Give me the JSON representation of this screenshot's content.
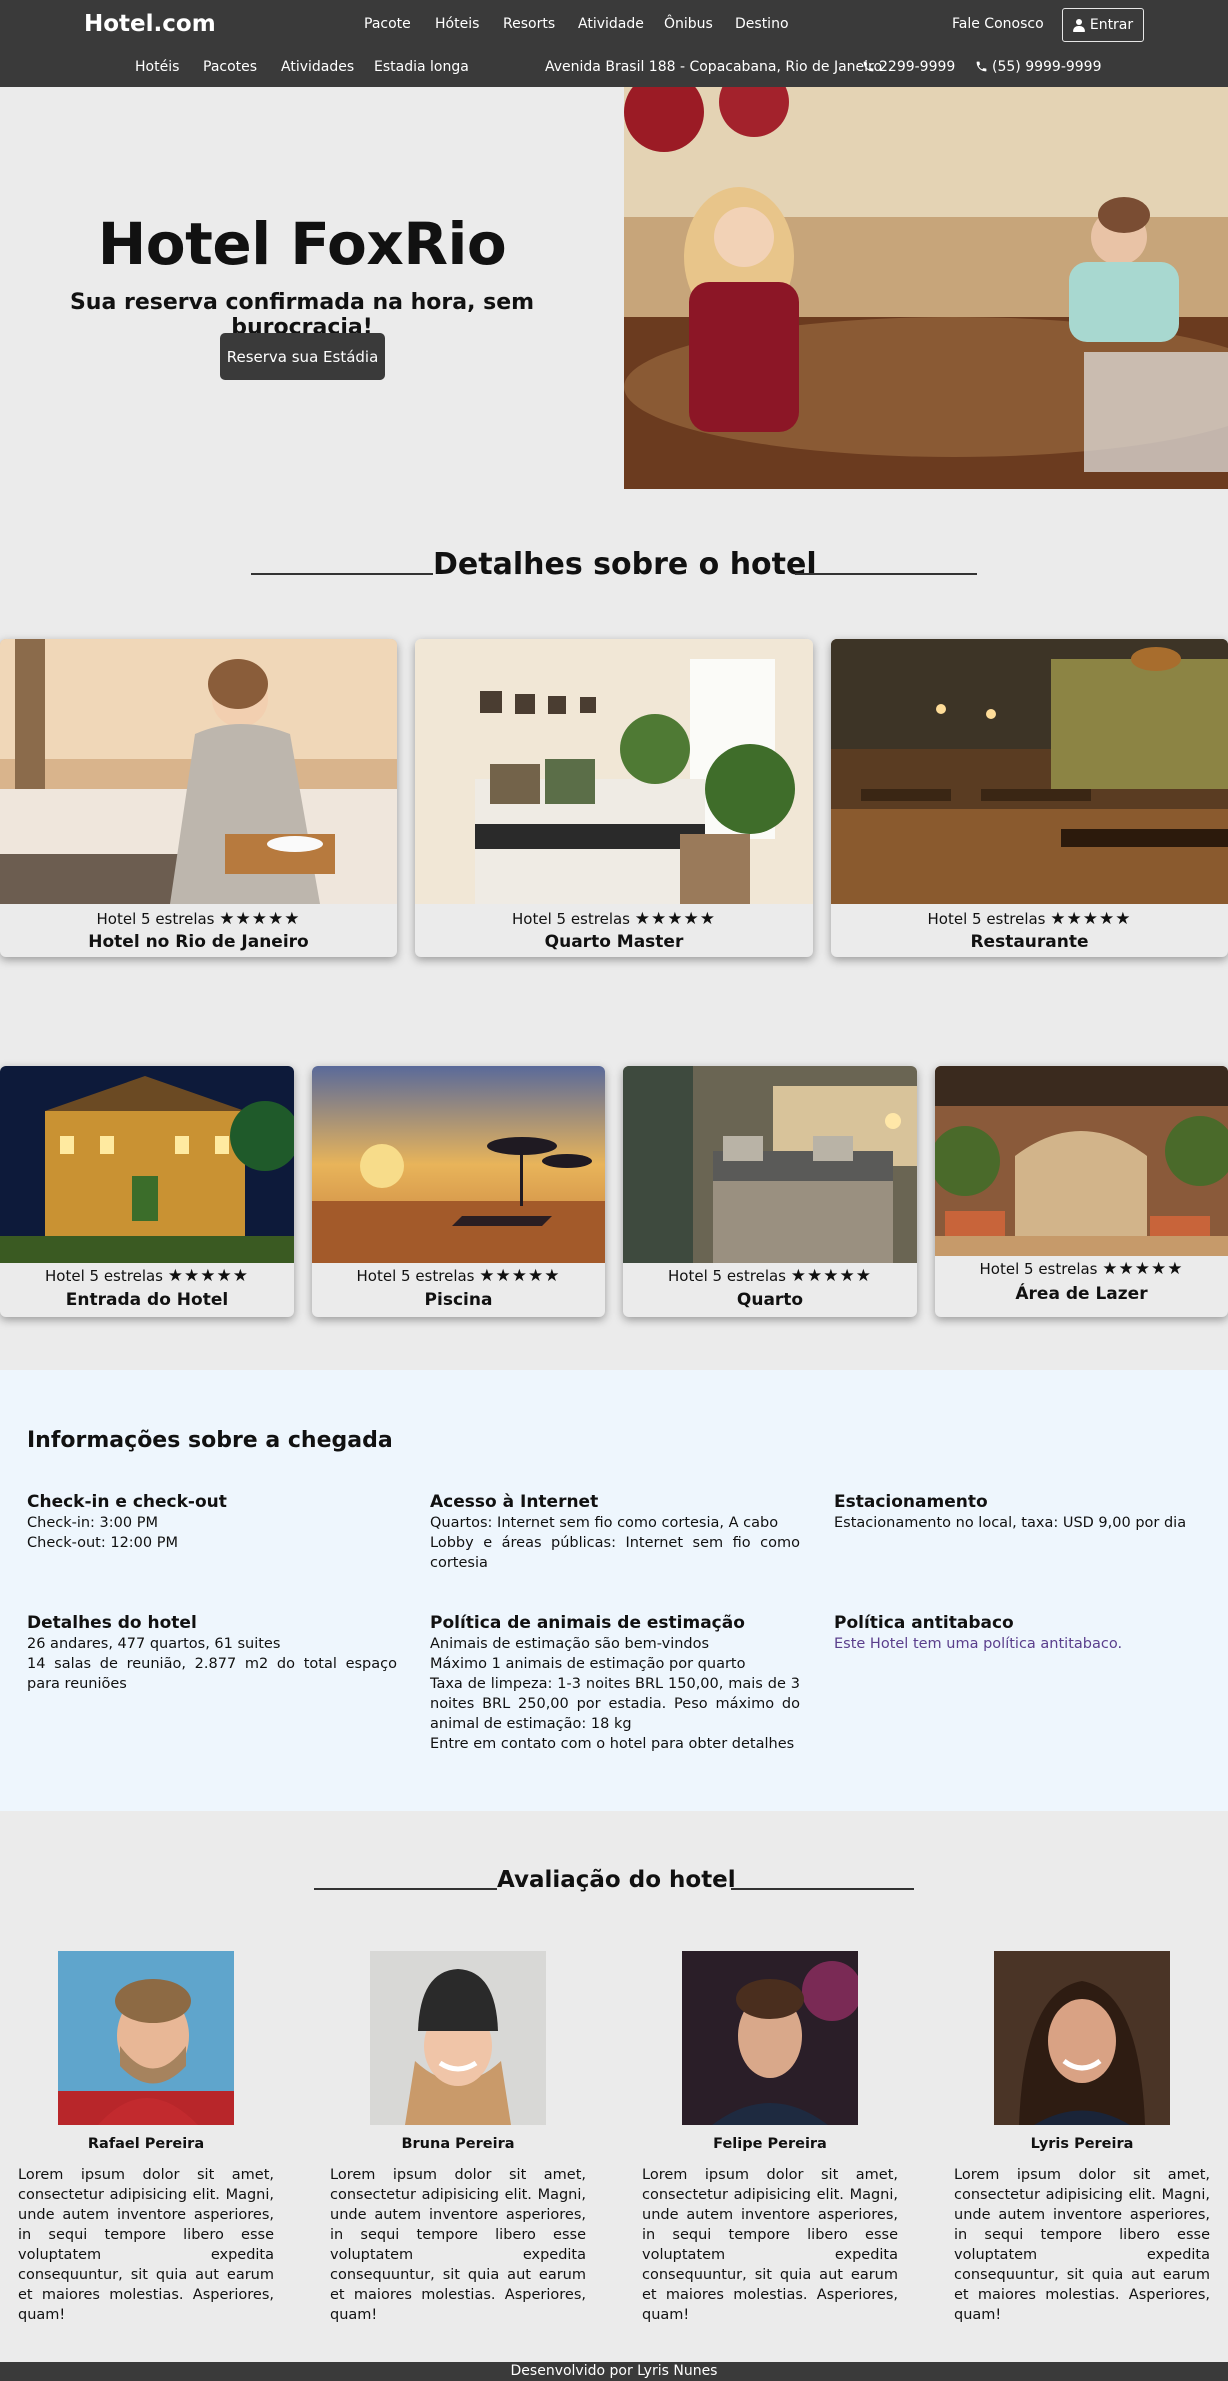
{
  "header": {
    "logo": "Hotel.com",
    "nav": [
      "Pacote",
      "Hóteis",
      "Resorts",
      "Atividade",
      "Ônibus",
      "Destino"
    ],
    "contact_link": "Fale Conosco",
    "login_label": "Entrar",
    "subnav": [
      "Hotéis",
      "Pacotes",
      "Atividades",
      "Estadia longa"
    ],
    "address": "Avenida Brasil 188 - Copacabana, Rio de Janeiro",
    "phone1": "2299-9999",
    "phone2": "(55) 9999-9999"
  },
  "hero": {
    "title": "Hotel FoxRio",
    "subtitle": "Sua reserva confirmada na hora, sem burocracia!",
    "button_label": "Reserva sua Estádia"
  },
  "details": {
    "title": "Detalhes sobre o hotel",
    "stars": "★★★★★",
    "cards_row1": [
      {
        "rating": "Hotel 5 estrelas",
        "title": "Hotel no Rio de Janeiro"
      },
      {
        "rating": "Hotel 5 estrelas",
        "title": "Quarto Master"
      },
      {
        "rating": "Hotel 5 estrelas",
        "title": "Restaurante"
      }
    ],
    "cards_row2": [
      {
        "rating": "Hotel 5 estrelas",
        "title": "Entrada do Hotel"
      },
      {
        "rating": "Hotel 5 estrelas",
        "title": "Piscina"
      },
      {
        "rating": "Hotel 5 estrelas",
        "title": "Quarto"
      },
      {
        "rating": "Hotel 5 estrelas",
        "title": "Área de Lazer"
      }
    ]
  },
  "arrival": {
    "title": "Informações sobre a chegada",
    "checkin": {
      "heading": "Check-in e check-out",
      "lines": [
        "Check-in: 3:00 PM",
        "Check-out: 12:00 PM"
      ]
    },
    "internet": {
      "heading": "Acesso à Internet",
      "lines": [
        "Quartos: Internet sem fio como cortesia, A cabo",
        "Lobby e áreas públicas: Internet sem fio como cortesia"
      ]
    },
    "parking": {
      "heading": "Estacionamento",
      "lines": [
        "Estacionamento no local, taxa: USD 9,00 por dia"
      ]
    },
    "hotel": {
      "heading": "Detalhes do hotel",
      "lines": [
        "26 andares, 477 quartos, 61 suites",
        "14 salas de reunião, 2.877 m2 do total espaço para reuniões"
      ]
    },
    "pets": {
      "heading": "Política de animais de estimação",
      "lines": [
        "Animais de estimação são bem-vindos",
        "Máximo 1 animais de estimação por quarto",
        "Taxa de limpeza: 1-3 noites BRL 150,00, mais de 3 noites BRL 250,00 por estadia. Peso máximo do animal de estimação: 18 kg",
        "Entre em contato com o hotel para obter detalhes"
      ]
    },
    "smoking": {
      "heading": "Política antitabaco",
      "link": "Este Hotel tem uma política antitabaco."
    }
  },
  "reviews": {
    "title": "Avaliação do hotel",
    "items": [
      {
        "name": "Rafael Pereira",
        "text": "Lorem ipsum dolor sit amet, consectetur adipisicing elit. Magni, unde autem inventore asperiores, in sequi tempore libero esse voluptatem expedita consequuntur, sit quia aut earum et maiores molestias. Asperiores, quam!"
      },
      {
        "name": "Bruna Pereira",
        "text": "Lorem ipsum dolor sit amet, consectetur adipisicing elit. Magni, unde autem inventore asperiores, in sequi tempore libero esse voluptatem expedita consequuntur, sit quia aut earum et maiores molestias. Asperiores, quam!"
      },
      {
        "name": "Felipe Pereira",
        "text": "Lorem ipsum dolor sit amet, consectetur adipisicing elit. Magni, unde autem inventore asperiores, in sequi tempore libero esse voluptatem expedita consequuntur, sit quia aut earum et maiores molestias. Asperiores, quam!"
      },
      {
        "name": "Lyris Pereira",
        "text": "Lorem ipsum dolor sit amet, consectetur adipisicing elit. Magni, unde autem inventore asperiores, in sequi tempore libero esse voluptatem expedita consequuntur, sit quia aut earum et maiores molestias. Asperiores, quam!"
      }
    ]
  },
  "footer": {
    "text": "Desenvolvido por Lyris Nunes"
  }
}
